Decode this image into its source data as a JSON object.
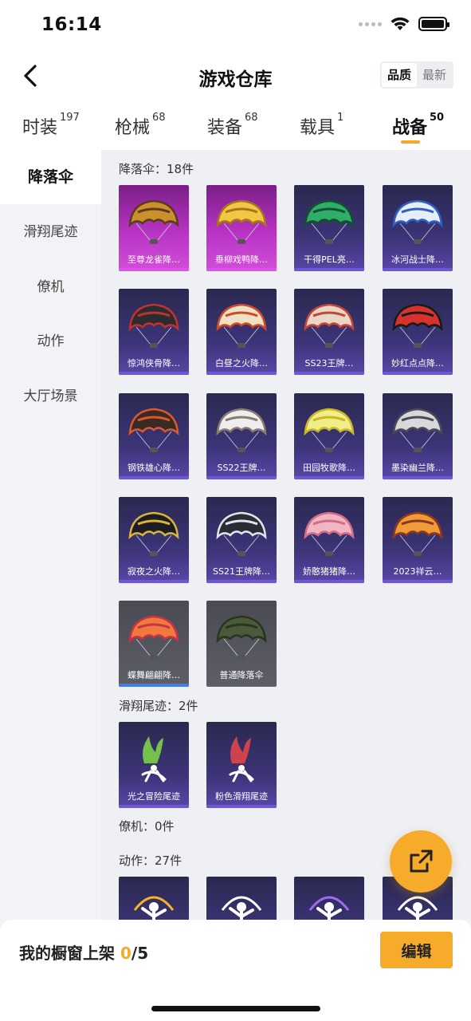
{
  "status": {
    "time": "16:14"
  },
  "nav": {
    "title": "游戏仓库",
    "sort_options": [
      "品质",
      "最新"
    ],
    "sort_active": 0
  },
  "tabs": [
    {
      "label": "时装",
      "count": "197"
    },
    {
      "label": "枪械",
      "count": "68"
    },
    {
      "label": "装备",
      "count": "68"
    },
    {
      "label": "载具",
      "count": "1"
    },
    {
      "label": "战备",
      "count": "50"
    }
  ],
  "active_tab": 4,
  "sidebar": [
    {
      "label": "降落伞"
    },
    {
      "label": "滑翔尾迹"
    },
    {
      "label": "僚机"
    },
    {
      "label": "动作"
    },
    {
      "label": "大厅场景"
    }
  ],
  "sections": {
    "parachute": {
      "title": "降落伞：18件"
    },
    "glide_trail": {
      "title": "滑翔尾迹：2件"
    },
    "wingman": {
      "title": "僚机：0件"
    },
    "emote": {
      "title": "动作：27件"
    }
  },
  "parachutes": [
    {
      "name": "至尊龙雀降…",
      "rarity": "legend",
      "colors": [
        "#c9902c",
        "#5b3a1e"
      ]
    },
    {
      "name": "垂柳戏鸭降…",
      "rarity": "legend",
      "colors": [
        "#f2c744",
        "#a8741c"
      ]
    },
    {
      "name": "干得PEL亮…",
      "rarity": "epic",
      "colors": [
        "#2fae6a",
        "#134f30"
      ]
    },
    {
      "name": "冰河战士降…",
      "rarity": "epic",
      "colors": [
        "#e6eef8",
        "#2f5fc9"
      ]
    },
    {
      "name": "惊鸿侠骨降…",
      "rarity": "epic",
      "colors": [
        "#2b2b32",
        "#c2312b"
      ]
    },
    {
      "name": "白昼之火降…",
      "rarity": "epic",
      "colors": [
        "#efe2c4",
        "#d04a2a"
      ]
    },
    {
      "name": "SS23王牌…",
      "rarity": "epic",
      "colors": [
        "#e9d6c4",
        "#c2463a"
      ]
    },
    {
      "name": "妙红点点降…",
      "rarity": "epic",
      "colors": [
        "#d8322f",
        "#1a1a1a"
      ]
    },
    {
      "name": "钢铁雄心降…",
      "rarity": "epic",
      "colors": [
        "#3a2a24",
        "#d9582c"
      ]
    },
    {
      "name": "SS22王牌…",
      "rarity": "epic",
      "colors": [
        "#eeeeee",
        "#8a7a70"
      ]
    },
    {
      "name": "田园牧歌降…",
      "rarity": "epic",
      "colors": [
        "#f1ee8a",
        "#c9b826"
      ]
    },
    {
      "name": "墨染幽兰降…",
      "rarity": "epic",
      "colors": [
        "#d9d9dc",
        "#4a4a52"
      ]
    },
    {
      "name": "寂夜之火降…",
      "rarity": "epic",
      "colors": [
        "#1c1c22",
        "#d8b43a"
      ]
    },
    {
      "name": "SS21王牌降…",
      "rarity": "epic",
      "colors": [
        "#2a2d36",
        "#e4e4ea"
      ]
    },
    {
      "name": "娇憨猪猪降…",
      "rarity": "epic",
      "colors": [
        "#f2b6c2",
        "#d36c86"
      ]
    },
    {
      "name": "2023祥云…",
      "rarity": "epic",
      "colors": [
        "#f09a3a",
        "#8a3a1c"
      ]
    },
    {
      "name": "蝶舞翩翩降…",
      "rarity": "common-blue",
      "colors": [
        "#f07a3a",
        "#c8324a"
      ]
    },
    {
      "name": "普通降落伞",
      "rarity": "common",
      "colors": [
        "#4a5a3a",
        "#2a3420"
      ]
    }
  ],
  "glide_trails": [
    {
      "name": "光之冒险尾迹",
      "colors": [
        "#7bd14a",
        "#ffffff"
      ]
    },
    {
      "name": "粉色滑翔尾迹",
      "colors": [
        "#e0454a",
        "#ffffff"
      ]
    }
  ],
  "emotes_preview": [
    {
      "colors": [
        "#f2b52a",
        "#ffffff"
      ]
    },
    {
      "colors": [
        "#ffffff",
        "#ffffff"
      ]
    },
    {
      "colors": [
        "#9a6cf0",
        "#ffffff"
      ]
    },
    {
      "colors": [
        "#ffffff",
        "#ffffff"
      ]
    }
  ],
  "bottom": {
    "showcase_label": "我的橱窗上架 ",
    "showcase_count": "0",
    "showcase_total": "/5",
    "edit_label": "编辑"
  }
}
